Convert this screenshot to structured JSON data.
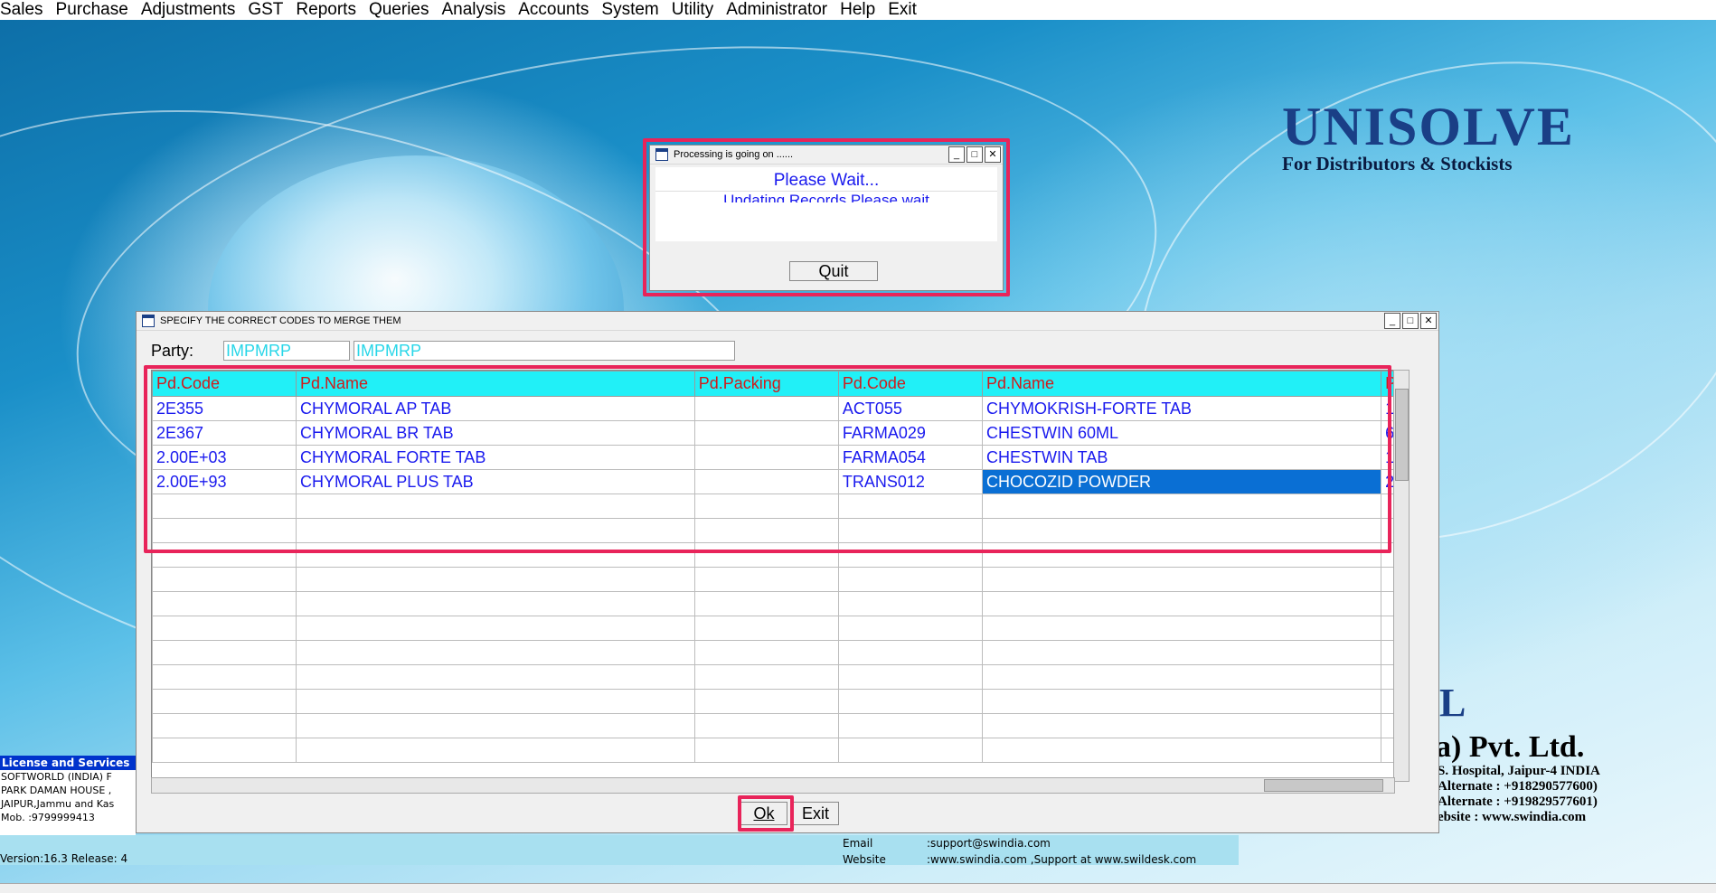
{
  "menu": [
    "Sales",
    "Purchase",
    "Adjustments",
    "GST",
    "Reports",
    "Queries",
    "Analysis",
    "Accounts",
    "System",
    "Utility",
    "Administrator",
    "Help",
    "Exit"
  ],
  "brand": {
    "name": "UNISOLVE",
    "tagline": "For Distributors & Stockists"
  },
  "company": {
    "partial_letters": "L",
    "name_tail": "a) Pvt. Ltd.",
    "address": "S. Hospital, Jaipur-4 INDIA",
    "alt1": "Alternate : +918290577600)",
    "alt2": "Alternate : +919829577601)",
    "website": "ebsite : www.swindia.com"
  },
  "info": {
    "header": "License and Services",
    "lines": [
      "SOFTWORLD (INDIA) F",
      "PARK DAMAN HOUSE ,",
      "JAIPUR,Jammu and Kas",
      "Mob. :9799999413"
    ],
    "version": "Version:16.3 Release: 4"
  },
  "contact": {
    "email_label": "Email",
    "email_value": ":support@swindia.com",
    "website_label": "Website",
    "website_value": ":www.swindia.com ,Support at www.swildesk.com"
  },
  "processing": {
    "title": "Processing is going on ......",
    "line1": "Please Wait...",
    "line2": "Updating Records Please wait",
    "quit_label": "Quit"
  },
  "merge": {
    "title": "SPECIFY THE CORRECT CODES TO MERGE THEM",
    "party_label": "Party:",
    "party_code": "IMPMRP",
    "party_name": "IMPMRP",
    "columns": [
      "Pd.Code",
      "Pd.Name",
      "Pd.Packing",
      "Pd.Code",
      "Pd.Name",
      "P"
    ],
    "rows": [
      [
        "2E355",
        "CHYMORAL AP TAB",
        "",
        "ACT055",
        "CHYMOKRISH-FORTE TAB",
        "1"
      ],
      [
        "2E367",
        "CHYMORAL BR TAB",
        "",
        "FARMA029",
        "CHESTWIN 60ML",
        "6"
      ],
      [
        "2.00E+03",
        "CHYMORAL FORTE TAB",
        "",
        "FARMA054",
        "CHESTWIN TAB",
        "1"
      ],
      [
        "2.00E+93",
        "CHYMORAL PLUS TAB",
        "",
        "TRANS012",
        "CHOCOZID POWDER",
        "2"
      ]
    ],
    "ok_label": "Ok",
    "exit_label": "Exit"
  }
}
